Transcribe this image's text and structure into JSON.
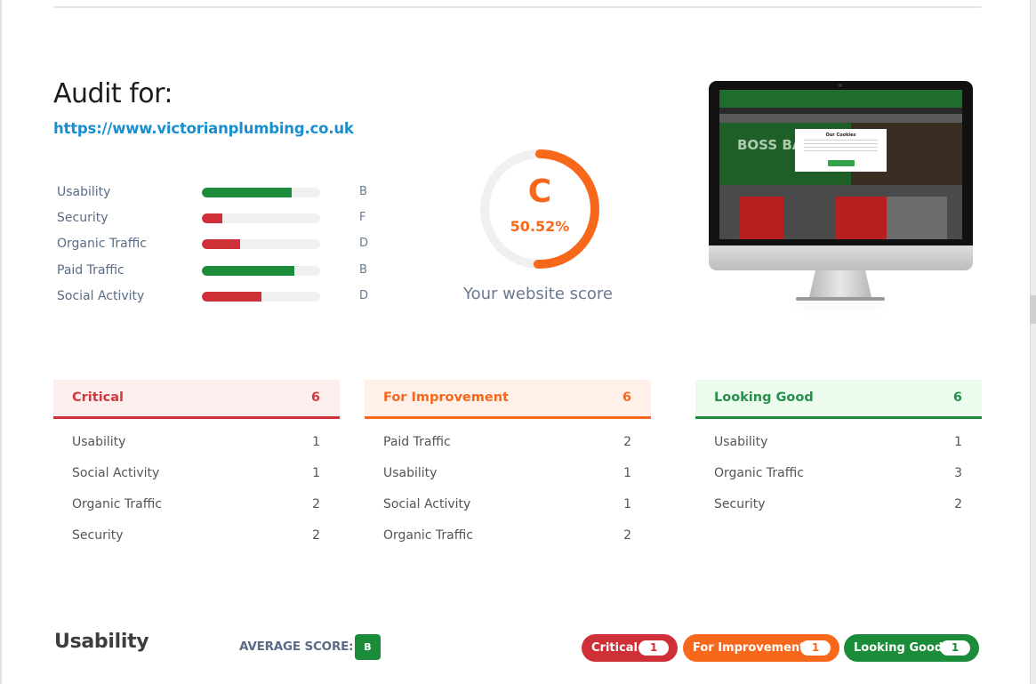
{
  "audit": {
    "title": "Audit for:",
    "url": "https://www.victorianplumbing.co.uk"
  },
  "metrics": [
    {
      "label": "Usability",
      "grade": "B",
      "progress": 0.76,
      "status": "good"
    },
    {
      "label": "Security",
      "grade": "F",
      "progress": 0.17,
      "status": "critical"
    },
    {
      "label": "Organic Traffic",
      "grade": "D",
      "progress": 0.32,
      "status": "critical"
    },
    {
      "label": "Paid Traffic",
      "grade": "B",
      "progress": 0.78,
      "status": "good"
    },
    {
      "label": "Social Activity",
      "grade": "D",
      "progress": 0.5,
      "status": "critical"
    }
  ],
  "score": {
    "grade": "C",
    "percent_label": "50.52%",
    "percent_value": 50.52,
    "caption": "Your website score"
  },
  "preview": {
    "image_alt": "website preview on monitor",
    "hero_text": "BOSS BATH",
    "cookie_title": "Our Cookies"
  },
  "summary": {
    "critical": {
      "title": "Critical",
      "count": "6",
      "rows": [
        {
          "label": "Usability",
          "count": "1"
        },
        {
          "label": "Social Activity",
          "count": "1"
        },
        {
          "label": "Organic Traffic",
          "count": "2"
        },
        {
          "label": "Security",
          "count": "2"
        }
      ]
    },
    "improvement": {
      "title": "For Improvement",
      "count": "6",
      "rows": [
        {
          "label": "Paid Traffic",
          "count": "2"
        },
        {
          "label": "Usability",
          "count": "1"
        },
        {
          "label": "Social Activity",
          "count": "1"
        },
        {
          "label": "Organic Traffic",
          "count": "2"
        }
      ]
    },
    "good": {
      "title": "Looking Good",
      "count": "6",
      "rows": [
        {
          "label": "Usability",
          "count": "1"
        },
        {
          "label": "Organic Traffic",
          "count": "3"
        },
        {
          "label": "Security",
          "count": "2"
        }
      ]
    }
  },
  "section": {
    "title": "Usability",
    "avg_label": "AVERAGE SCORE:",
    "avg_grade": "B",
    "pills": [
      {
        "label": "Critical",
        "count": "1"
      },
      {
        "label": "For Improvement",
        "count": "1"
      },
      {
        "label": "Looking Good",
        "count": "1"
      }
    ]
  },
  "colors": {
    "good": "#1a8c3a",
    "critical": "#cf2f36",
    "improvement": "#f7681b",
    "link": "#1a8fd0",
    "track": "#f0f0f0"
  }
}
